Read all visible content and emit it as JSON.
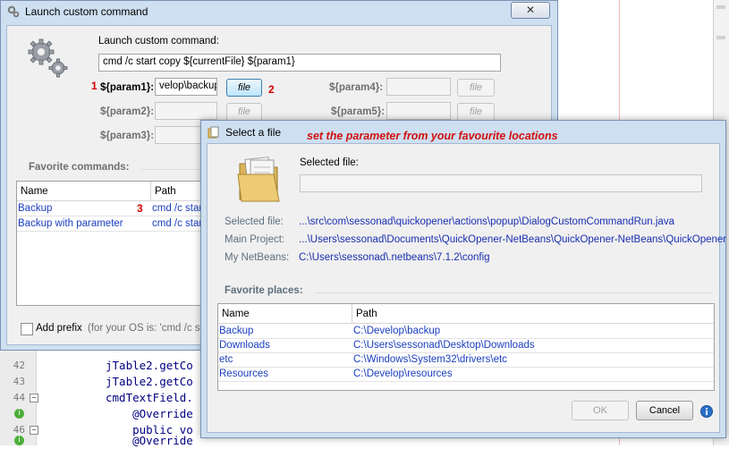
{
  "editor": {
    "lines": [
      {
        "num": "42",
        "code": "jTable2.getCo",
        "marker": ""
      },
      {
        "num": "43",
        "code": "jTable2.getCo",
        "marker": ""
      },
      {
        "num": "44",
        "code": "cmdTextField.",
        "marker": "fold"
      },
      {
        "num": "",
        "code": "    @Override",
        "marker": "impl"
      },
      {
        "num": "46",
        "code": "    public vo",
        "marker": "fold"
      },
      {
        "num": "",
        "code": "    @Override",
        "marker": "impl"
      }
    ]
  },
  "launch_dialog": {
    "title": "Launch custom command",
    "close_label": "✕",
    "command_label": "Launch custom command:",
    "command_value": "cmd /c start copy ${currentFile} ${param1}",
    "params_left": [
      {
        "label": "${param1}:",
        "value": "velop\\backup",
        "file_label": "file",
        "enabled": true
      },
      {
        "label": "${param2}:",
        "value": "",
        "file_label": "file",
        "enabled": false
      },
      {
        "label": "${param3}:",
        "value": "",
        "file_label": "file",
        "enabled": false
      }
    ],
    "params_right": [
      {
        "label": "${param4}:",
        "value": "",
        "file_label": "file"
      },
      {
        "label": "${param5}:",
        "value": "",
        "file_label": "file"
      }
    ],
    "favorites_label": "Favorite commands:",
    "table_headers": [
      "Name",
      "Path"
    ],
    "rows": [
      {
        "name": "Backup",
        "path": "cmd /c start"
      },
      {
        "name": "Backup with  parameter",
        "path": "cmd /c start"
      }
    ],
    "add_prefix_label": "Add prefix",
    "prefix_hint": "(for your OS is: 'cmd /c sta"
  },
  "steps": {
    "one": "1",
    "two": "2",
    "three": "3"
  },
  "select_dialog": {
    "title": "Select a file",
    "annotation": "set the parameter from your favourite locations",
    "selected_file_caption": "Selected file:",
    "selected_file_value": "",
    "info": [
      {
        "label": "Selected file:",
        "value": "...\\src\\com\\sessonad\\quickopener\\actions\\popup\\DialogCustomCommandRun.java"
      },
      {
        "label": "Main Project:",
        "value": "...\\Users\\sessonad\\Documents\\QuickOpener-NetBeans\\QuickOpener-NetBeans\\QuickOpener"
      },
      {
        "label": "My NetBeans:",
        "value": "C:\\Users\\sessonad\\.netbeans\\7.1.2\\config"
      }
    ],
    "favorite_places_label": "Favorite places:",
    "table_headers": [
      "Name",
      "Path"
    ],
    "rows": [
      {
        "name": "Backup",
        "path": "C:\\Develop\\backup"
      },
      {
        "name": "Downloads",
        "path": "C:\\Users\\sessonad\\Desktop\\Downloads"
      },
      {
        "name": "etc",
        "path": "C:\\Windows\\System32\\drivers\\etc"
      },
      {
        "name": "Resources",
        "path": "C:\\Develop\\resources"
      }
    ],
    "ok_label": "OK",
    "cancel_label": "Cancel"
  },
  "colors": {
    "accent_red": "#d00000",
    "link_blue": "#1a2fb0",
    "window_frame": "#cddff0"
  }
}
